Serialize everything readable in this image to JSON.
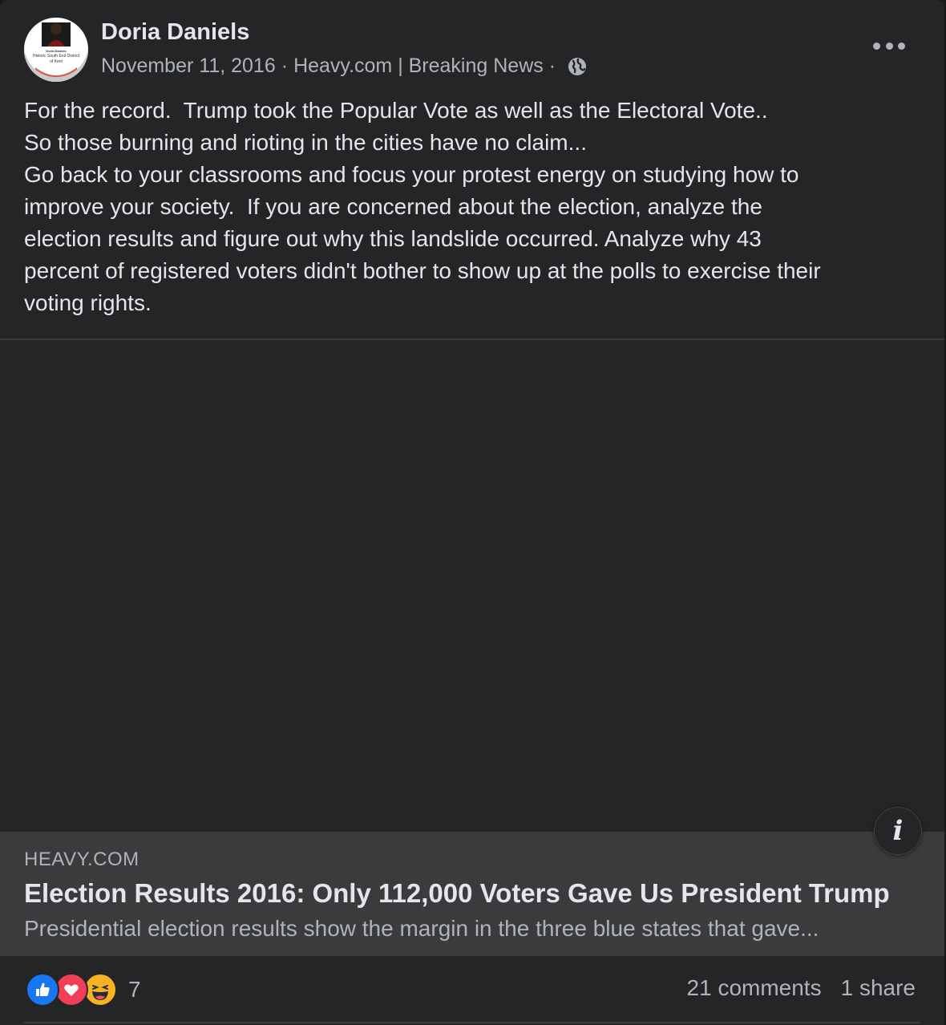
{
  "post": {
    "author": "Doria Daniels",
    "date": "November 11, 2016",
    "separator": "·",
    "source": "Heavy.com | Breaking News",
    "privacy_icon": "globe-icon",
    "avatar": {
      "caption_line1": "Doria Daniels",
      "caption_line2": "Historic South End District",
      "caption_line3": "of Kent"
    },
    "text_lines": [
      "For the record.  Trump took the Popular Vote as well as the Electoral Vote..",
      "So those burning and rioting in the cities have no claim...",
      "Go back to your classrooms and focus your protest energy on studying how to",
      "improve your society.  If you are concerned about the election, analyze the",
      "election results and figure out why this landslide occurred. Analyze why 43",
      "percent of registered voters didn't bother to show up at the polls to exercise their",
      "voting rights."
    ]
  },
  "link_preview": {
    "domain": "HEAVY.COM",
    "headline": "Election Results 2016: Only 112,000 Voters Gave Us President Trump",
    "subtitle": "Presidential election results show the margin in the three blue states that gave...",
    "info_label": "i"
  },
  "footer": {
    "reaction_icons": [
      "like-icon",
      "love-icon",
      "haha-icon"
    ],
    "reaction_count": "7",
    "comments": "21 comments",
    "shares": "1 share"
  },
  "colors": {
    "card_bg": "#242526",
    "preview_bg": "#3a3b3c",
    "primary_text": "#e4e6eb",
    "secondary_text": "#b0b3b8",
    "like_blue": "#1877f2",
    "love_red": "#f33e58",
    "haha_yellow": "#f7b125"
  }
}
